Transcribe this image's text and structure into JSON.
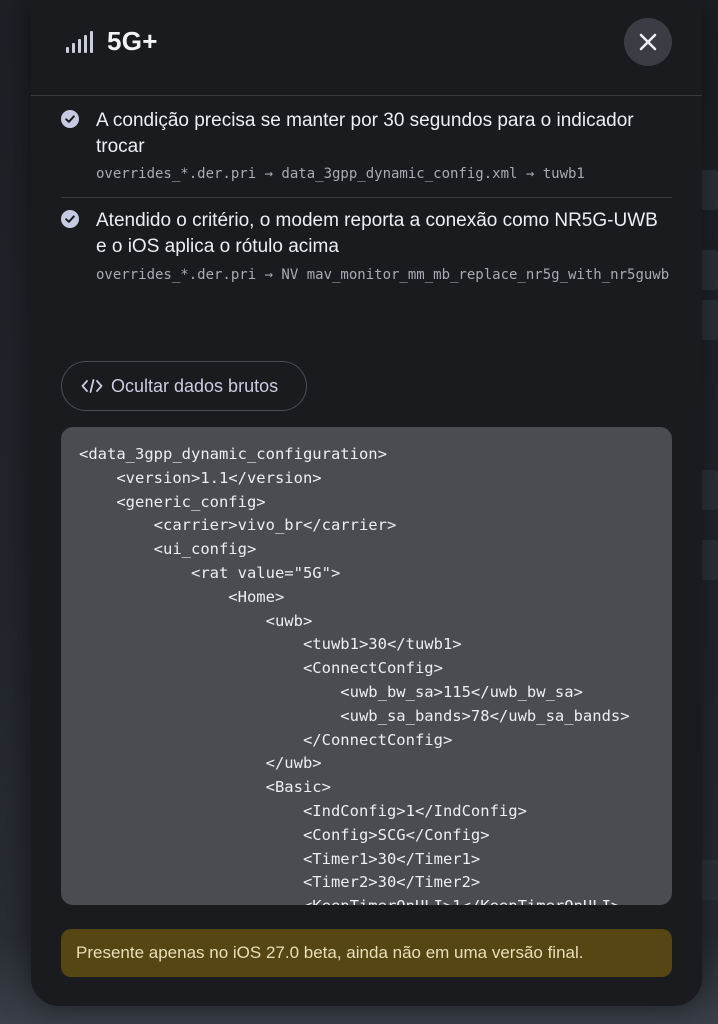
{
  "header": {
    "title": "5G+",
    "signal_icon": "signal-bars-icon",
    "close_icon": "close-icon"
  },
  "steps": [
    {
      "text": "A condição precisa se manter por 30 segundos para o indicador trocar",
      "path": "overrides_*.der.pri → data_3gpp_dynamic_config.xml → tuwb1",
      "icon": "check-circle-icon"
    },
    {
      "text": "Atendido o critério, o modem reporta a conexão como NR5G-UWB e o iOS aplica o rótulo acima",
      "path": "overrides_*.der.pri → NV mav_monitor_mm_mb_replace_nr5g_with_nr5guwb",
      "icon": "check-circle-icon"
    }
  ],
  "raw_toggle": {
    "label": "Ocultar dados brutos",
    "icon": "code-icon"
  },
  "raw_data": "<data_3gpp_dynamic_configuration>\n    <version>1.1</version>\n    <generic_config>\n        <carrier>vivo_br</carrier>\n        <ui_config>\n            <rat value=\"5G\">\n                <Home>\n                    <uwb>\n                        <tuwb1>30</tuwb1>\n                        <ConnectConfig>\n                            <uwb_bw_sa>115</uwb_bw_sa>\n                            <uwb_sa_bands>78</uwb_sa_bands>\n                        </ConnectConfig>\n                    </uwb>\n                    <Basic>\n                        <IndConfig>1</IndConfig>\n                        <Config>SCG</Config>\n                        <Timer1>30</Timer1>\n                        <Timer2>30</Timer2>\n                        <KeepTimerOnULI>1</KeepTimerOnULI>",
  "notice": {
    "text": "Presente apenas no iOS 27.0 beta, ainda não em uma versão final."
  },
  "colors": {
    "modal_bg": "#1a1b1f",
    "accent": "#c7cbe2",
    "code_bg": "#4a4c52",
    "notice_bg": "#564614",
    "notice_text": "#e9dfb8"
  }
}
